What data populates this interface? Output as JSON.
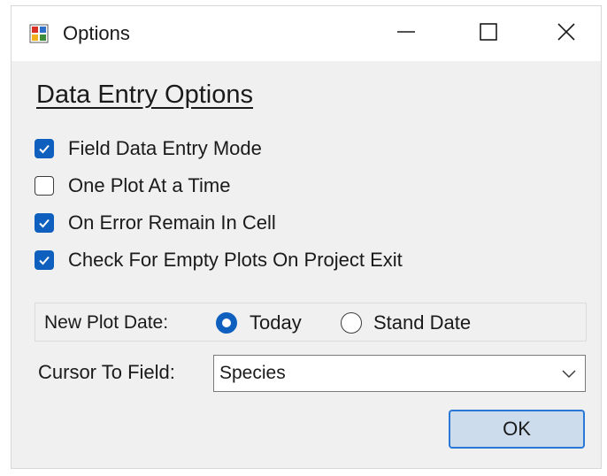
{
  "window": {
    "title": "Options",
    "icon": "application-form-icon"
  },
  "heading": "Data Entry Options",
  "checkboxes": [
    {
      "label": "Field Data Entry Mode",
      "checked": true
    },
    {
      "label": "One Plot At a Time",
      "checked": false
    },
    {
      "label": "On Error Remain In Cell",
      "checked": true
    },
    {
      "label": "Check For Empty Plots On Project Exit",
      "checked": true
    }
  ],
  "new_plot_date": {
    "label": "New Plot Date:",
    "options": [
      {
        "label": "Today",
        "selected": true
      },
      {
        "label": "Stand Date",
        "selected": false
      }
    ]
  },
  "cursor_to_field": {
    "label": "Cursor To Field:",
    "value": "Species"
  },
  "ok_label": "OK",
  "colors": {
    "accent": "#0f5fbf",
    "ok_button_bg": "#ccdcec",
    "ok_button_border": "#2a78d6",
    "window_bg": "#f0f0f0"
  }
}
